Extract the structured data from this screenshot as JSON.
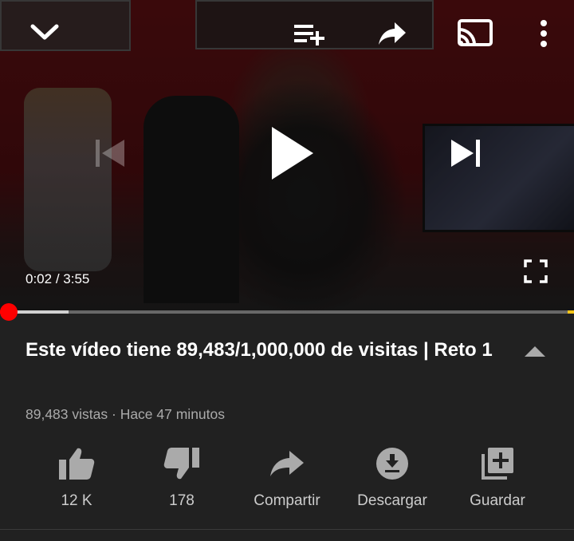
{
  "player": {
    "current_time": "0:02",
    "separator": " / ",
    "duration": "3:55",
    "progress_fraction": 0.0085,
    "buffer_fraction": 0.12,
    "progress_color": "#ff0000"
  },
  "top_controls": [
    "chevron-down-icon",
    "add-to-queue-icon",
    "share-icon",
    "cast-icon",
    "more-vert-icon"
  ],
  "center_controls": [
    "skip-previous-icon",
    "play-icon",
    "skip-next-icon"
  ],
  "video": {
    "title": "Este vídeo tiene 89,483/1,000,000 de visitas | Reto 1",
    "views": "89,483 vistas",
    "meta_separator": " · ",
    "posted": "Hace 47 minutos"
  },
  "actions": [
    {
      "icon": "thumb-up-icon",
      "label": "12 K"
    },
    {
      "icon": "thumb-down-icon",
      "label": "178"
    },
    {
      "icon": "share-icon",
      "label": "Compartir"
    },
    {
      "icon": "download-icon",
      "label": "Descargar"
    },
    {
      "icon": "add-to-playlist-icon",
      "label": "Guardar"
    }
  ]
}
